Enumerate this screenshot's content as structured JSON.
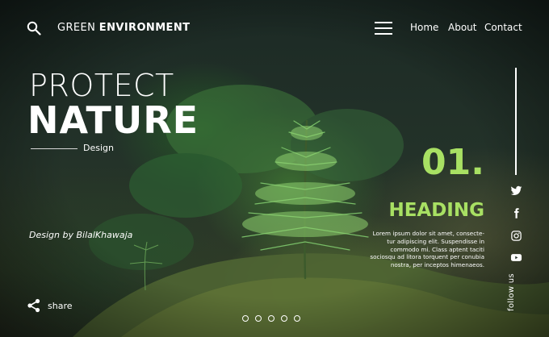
{
  "header": {
    "brand_light": "GREEN ",
    "brand_bold": "ENVIRONMENT",
    "nav": [
      "Home",
      "About",
      "Contact"
    ]
  },
  "hero": {
    "title_line1": "PROTECT",
    "title_line2": "NATURE",
    "design_label": "Design",
    "credit": "Design by BilalKhawaja"
  },
  "slide": {
    "number": "01.",
    "heading": "HEADING",
    "body": "Lorem ipsum dolor sit amet, consecte-tur adipiscing elit. Suspendisse in commodo mi. Class aptent taciti sociosqu ad litora torquent per conubia nostra, per inceptos himenaeos."
  },
  "social": {
    "follow_label": "follow us",
    "icons": [
      "twitter-icon",
      "facebook-icon",
      "instagram-icon",
      "youtube-icon"
    ]
  },
  "footer": {
    "share_label": "share",
    "pager_count": 5
  },
  "colors": {
    "accent": "#a8e063",
    "text": "#ffffff",
    "background": "#1f2b24"
  }
}
